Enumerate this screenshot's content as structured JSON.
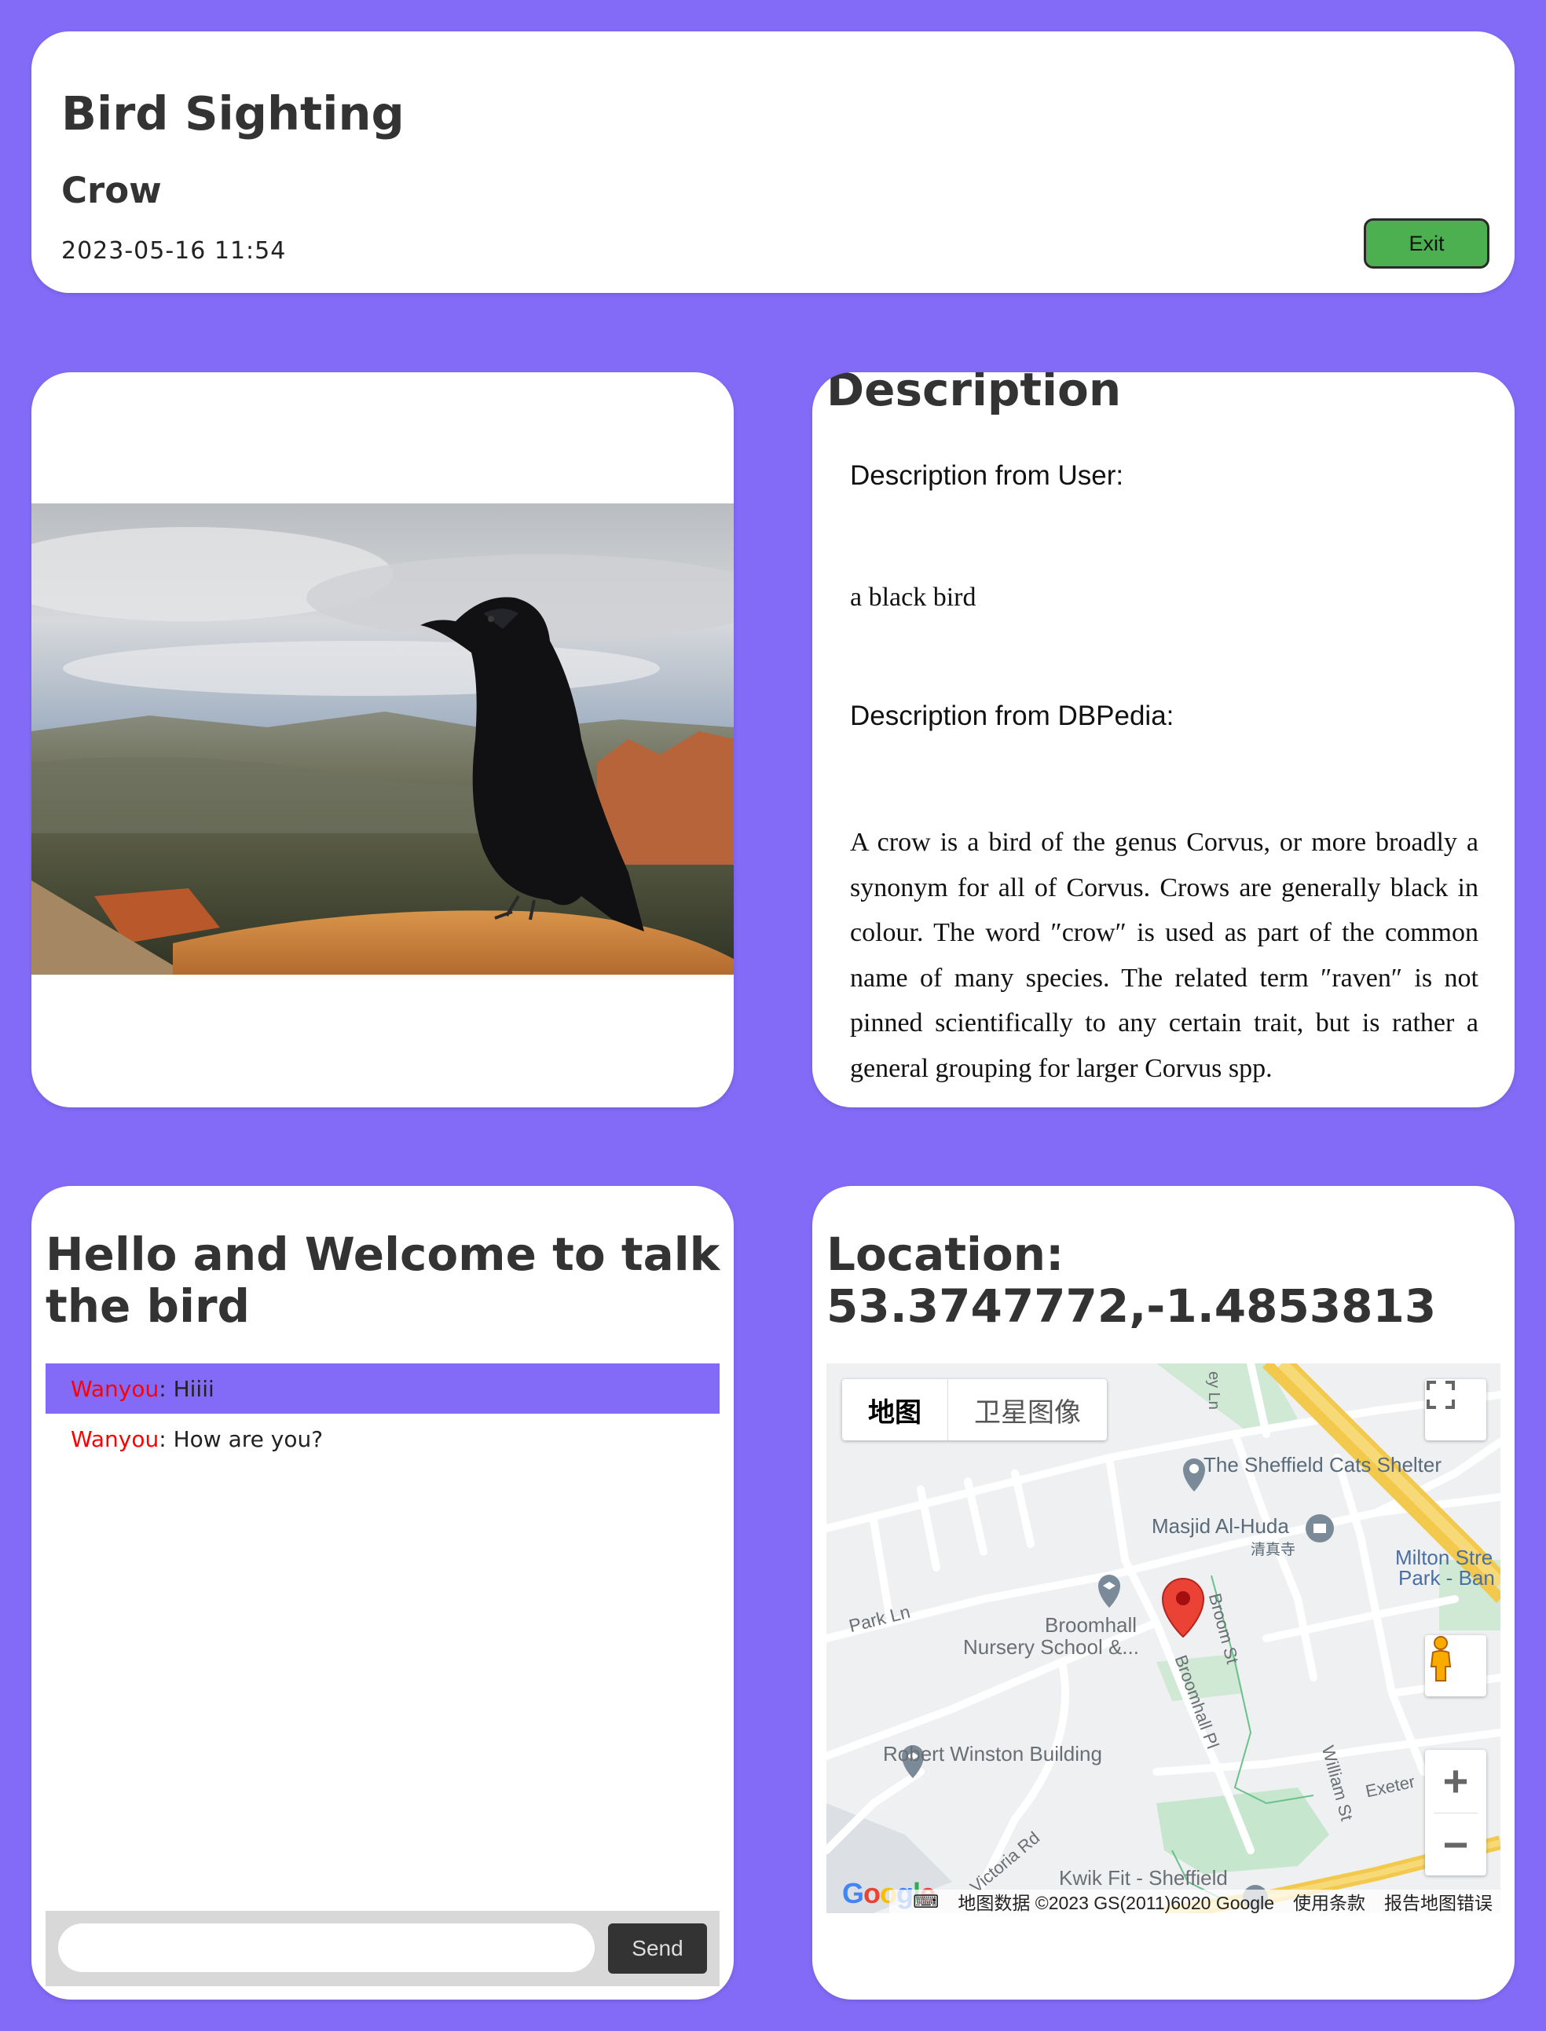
{
  "header": {
    "title": "Bird Sighting",
    "bird_name": "Crow",
    "date": "2023-05-16 11:54",
    "exit_label": "Exit"
  },
  "description": {
    "title": "Description",
    "user_label": "Description from User:",
    "user_text": "a black bird",
    "dbpedia_label": "Description from DBPedia:",
    "dbpedia_text": "A crow is a bird of the genus Corvus, or more broadly a synonym for all of Corvus. Crows are generally black in colour. The word ″crow″ is used as part of the common name of many species. The related term ″raven″ is not pinned scientifically to any certain trait, but is rather a general grouping for larger Corvus spp."
  },
  "chat": {
    "title": "Hello and Welcome to talk the bird",
    "messages": [
      {
        "sender": "Wanyou",
        "text": "Hiiii"
      },
      {
        "sender": "Wanyou",
        "text": "How are you?"
      }
    ],
    "input_placeholder": "",
    "send_label": "Send"
  },
  "location": {
    "title": "Location: 53.3747772,-1.4853813",
    "map_type_options": [
      "地图",
      "卫星图像"
    ],
    "selected_map_type": "地图",
    "places": {
      "cats_shelter": "The Sheffield Cats Shelter",
      "masjid": "Masjid Al-Huda",
      "masjid_cn": "清真寺",
      "milton": "Milton Stre",
      "milton2": "Park - Ban",
      "park_ln": "Park Ln",
      "broomhall1": "Broomhall",
      "broomhall2": "Nursery School &...",
      "broom_st": "Broom St",
      "broomhall_pl": "Broomhall Pl",
      "robert": "Robert Winston Building",
      "william": "William St",
      "exeter": "Exeter",
      "victoria": "Victoria Rd",
      "kwik": "Kwik Fit - Sheffield",
      "ey_ln": "ey Ln"
    },
    "footer": {
      "map_data": "地图数据 ©2023 GS(2011)6020 Google",
      "terms": "使用条款",
      "report": "报告地图错误"
    },
    "google": "Google"
  },
  "icons": {
    "fullscreen": "fullscreen-icon",
    "pegman": "pegman-icon",
    "zoom_in": "plus-icon",
    "zoom_out": "minus-icon",
    "pin": "map-pin-icon"
  },
  "colors": {
    "page_bg": "#836bf7",
    "exit_button": "#4caf50",
    "sender_name": "#ff0000",
    "highlight_row": "#836bf7",
    "send_button": "#333333"
  }
}
